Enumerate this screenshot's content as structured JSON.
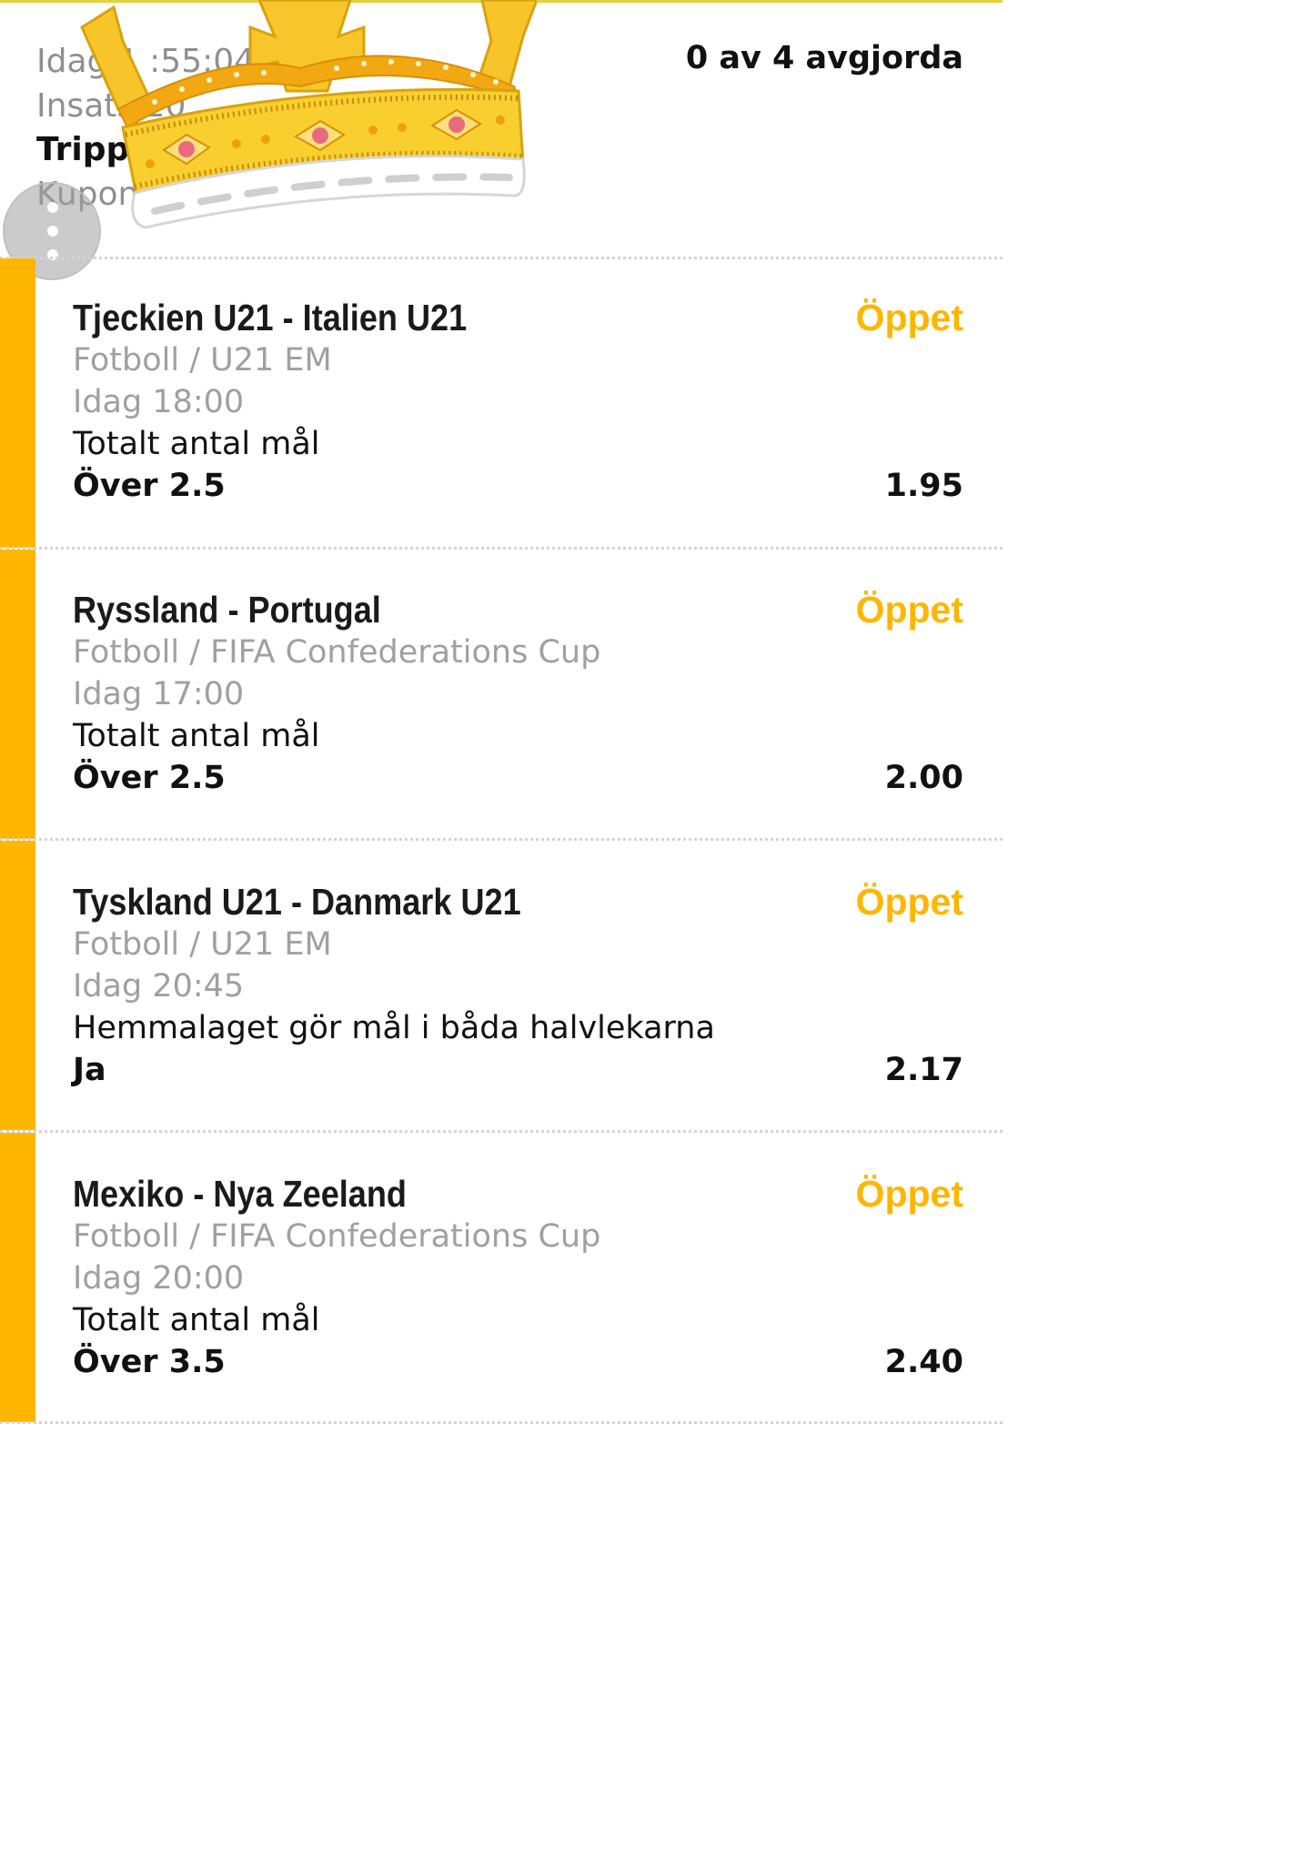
{
  "header": {
    "line1": "Idag 1 :55:04",
    "line2": "Insats 20",
    "line3": "Trippla",
    "line4": "Kupong",
    "status": "0 av 4 avgjorda"
  },
  "colors": {
    "accent": "#ffb600",
    "text": "#111111",
    "muted": "#a0a0a0"
  },
  "icons": {
    "menu": "more-vert-icon",
    "sticker": "crown-sticker"
  },
  "bets": [
    {
      "match": "Tjeckien U21 - Italien U21",
      "status": "Öppet",
      "league": "Fotboll / U21 EM",
      "time": "Idag 18:00",
      "market": "Totalt antal mål",
      "selection": "Över 2.5",
      "odds": "1.95"
    },
    {
      "match": "Ryssland - Portugal",
      "status": "Öppet",
      "league": "Fotboll / FIFA Confederations Cup",
      "time": "Idag 17:00",
      "market": "Totalt antal mål",
      "selection": "Över 2.5",
      "odds": "2.00"
    },
    {
      "match": "Tyskland U21 - Danmark U21",
      "status": "Öppet",
      "league": "Fotboll / U21 EM",
      "time": "Idag 20:45",
      "market": "Hemmalaget gör mål i båda halvlekarna",
      "selection": "Ja",
      "odds": "2.17"
    },
    {
      "match": "Mexiko - Nya Zeeland",
      "status": "Öppet",
      "league": "Fotboll / FIFA Confederations Cup",
      "time": "Idag 20:00",
      "market": "Totalt antal mål",
      "selection": "Över 3.5",
      "odds": "2.40"
    }
  ]
}
